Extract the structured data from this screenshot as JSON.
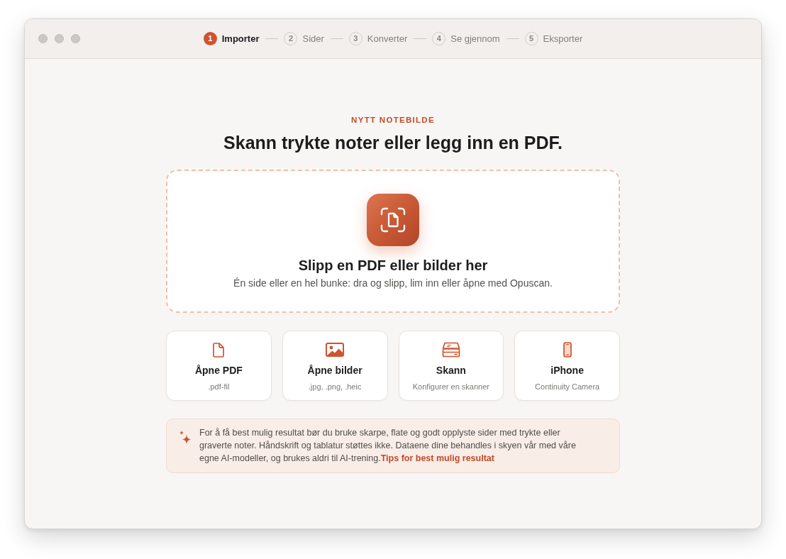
{
  "stepper": [
    {
      "number": "1",
      "label": "Importer",
      "selected": true
    },
    {
      "number": "2",
      "label": "Sider",
      "selected": false
    },
    {
      "number": "3",
      "label": "Konverter",
      "selected": false
    },
    {
      "number": "4",
      "label": "Se gjennom",
      "selected": false
    },
    {
      "number": "5",
      "label": "Eksporter",
      "selected": false
    }
  ],
  "eyebrow": "NYTT NOTEBILDE",
  "heading": "Skann trykte noter eller legg inn en PDF.",
  "drop_zone": {
    "title": "Slipp en PDF eller bilder her",
    "subtitle": "Én side eller en hel bunke: dra og slipp, lim inn eller åpne med Opuscan."
  },
  "options": [
    {
      "kind": "pdf",
      "title": "Åpne PDF",
      "subtitle": ".pdf-fil"
    },
    {
      "kind": "images",
      "title": "Åpne bilder",
      "subtitle": ".jpg, .png, .heic"
    },
    {
      "kind": "scanner",
      "title": "Skann",
      "subtitle": "Konfigurer en skanner"
    },
    {
      "kind": "phone",
      "title": "iPhone",
      "subtitle": "Continuity Camera"
    }
  ],
  "note": {
    "text": "For å få best mulig resultat bør du bruke skarpe, flate og godt opplyste sider med trykte eller graverte noter. Håndskrift og tablatur støttes ikke. Dataene dine behandles i skyen vår med våre egne AI-modeller, og brukes aldri til AI-trening.",
    "link": "Tips for best mulig resultat"
  }
}
